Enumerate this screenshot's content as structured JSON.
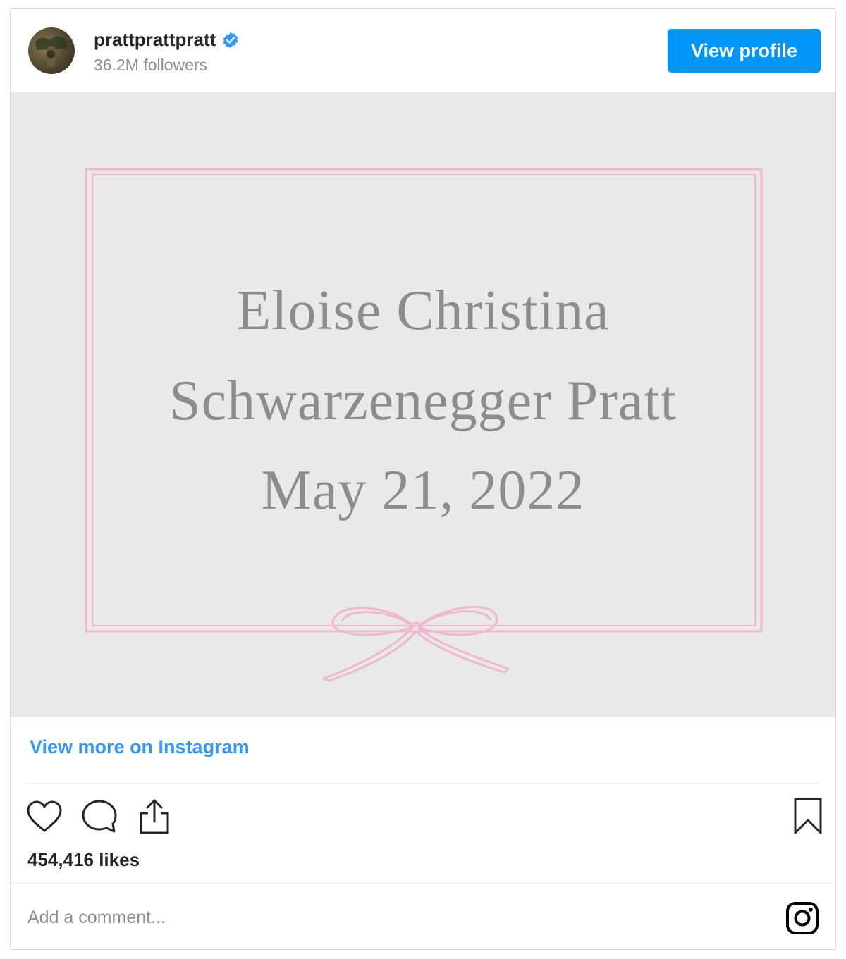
{
  "post": {
    "username": "prattprattpratt",
    "followers": "36.2M followers",
    "view_profile_label": "View profile",
    "view_more_label": "View more on Instagram",
    "likes": "454,416 likes",
    "comment_placeholder": "Add a comment..."
  },
  "card": {
    "line1": "Eloise Christina",
    "line2": "Schwarzenegger Pratt",
    "line3": "May 21, 2022",
    "frame_color": "#f0b8cc"
  },
  "icons": {
    "verified": "verified-badge-icon",
    "like": "heart-icon",
    "comment": "comment-bubble-icon",
    "share": "share-upload-icon",
    "save": "bookmark-icon",
    "brand": "instagram-glyph-icon"
  },
  "colors": {
    "accent": "#0095f6",
    "link": "#3897f0",
    "verified": "#3897f0",
    "card_background": "#e9e9e9",
    "card_text": "#8d8d8d"
  }
}
